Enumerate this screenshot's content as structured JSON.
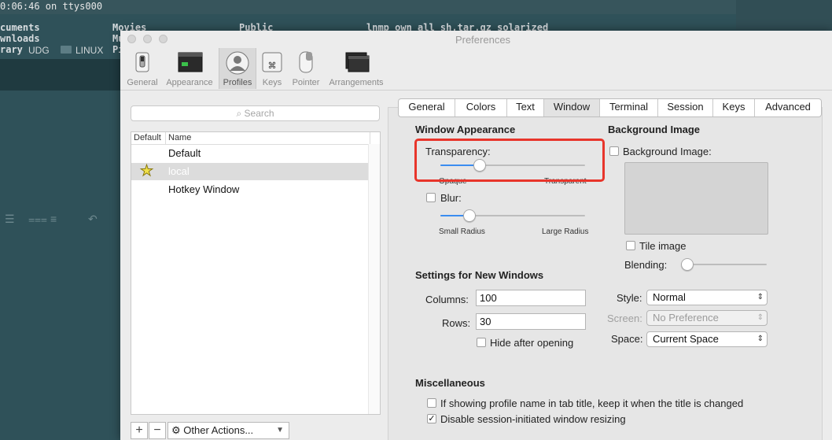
{
  "terminal": {
    "title": "0:06:46 on ttys000",
    "lines": [
      {
        "left": "cuments",
        "mid": "Movies",
        "right": "Public",
        "far": "lnmp_own_all_sh.tar.gz solarized"
      },
      {
        "left": "wnloads",
        "mid": "Mu"
      },
      {
        "left": "rary",
        "mid": "Pi"
      }
    ],
    "bookmarks": [
      "UDG",
      "LINUX"
    ]
  },
  "window": {
    "title": "Preferences"
  },
  "toolbar": {
    "items": [
      {
        "label": "General",
        "icon": "general-switch-icon"
      },
      {
        "label": "Appearance",
        "icon": "appearance-window-icon"
      },
      {
        "label": "Profiles",
        "icon": "profiles-user-icon"
      },
      {
        "label": "Keys",
        "icon": "keys-command-icon"
      },
      {
        "label": "Pointer",
        "icon": "pointer-mouse-icon"
      },
      {
        "label": "Arrangements",
        "icon": "arrangements-windows-icon"
      }
    ],
    "selected": "Profiles"
  },
  "profiles": {
    "search_placeholder": "Search",
    "headers": {
      "default": "Default",
      "name": "Name"
    },
    "rows": [
      {
        "name": "Default",
        "is_default": false,
        "selected": false
      },
      {
        "name": "local",
        "is_default": true,
        "selected": true
      },
      {
        "name": "Hotkey Window",
        "is_default": false,
        "selected": false
      }
    ],
    "add_label": "+",
    "remove_label": "−",
    "actions_label": "Other Actions..."
  },
  "tabs": {
    "items": [
      "General",
      "Colors",
      "Text",
      "Window",
      "Terminal",
      "Session",
      "Keys",
      "Advanced"
    ],
    "selected": "Window"
  },
  "window_tab": {
    "appearance": {
      "title": "Window Appearance",
      "transparency_label": "Transparency:",
      "transparency_value": 0.25,
      "transparency_min_label": "Opaque",
      "transparency_max_label": "Transparent",
      "blur_label": "Blur:",
      "blur_checked": false,
      "blur_value": 0.17,
      "blur_min_label": "Small Radius",
      "blur_max_label": "Large Radius"
    },
    "background": {
      "title": "Background Image",
      "checkbox_label": "Background Image:",
      "checked": false,
      "tile_label": "Tile image",
      "tile_checked": false,
      "blending_label": "Blending:",
      "blending_value": 0.0
    },
    "new_windows": {
      "title": "Settings for New Windows",
      "columns_label": "Columns:",
      "columns_value": "100",
      "rows_label": "Rows:",
      "rows_value": "30",
      "hide_label": "Hide after opening",
      "hide_checked": false,
      "style_label": "Style:",
      "style_value": "Normal",
      "screen_label": "Screen:",
      "screen_value": "No Preference",
      "space_label": "Space:",
      "space_value": "Current Space"
    },
    "misc": {
      "title": "Miscellaneous",
      "option1_label": "If showing profile name in tab title, keep it when the title is changed",
      "option1_checked": false,
      "option2_label": "Disable session-initiated window resizing",
      "option2_checked": true
    }
  },
  "colors": {
    "highlight": "#e8352b",
    "accent": "#3b8df0"
  }
}
